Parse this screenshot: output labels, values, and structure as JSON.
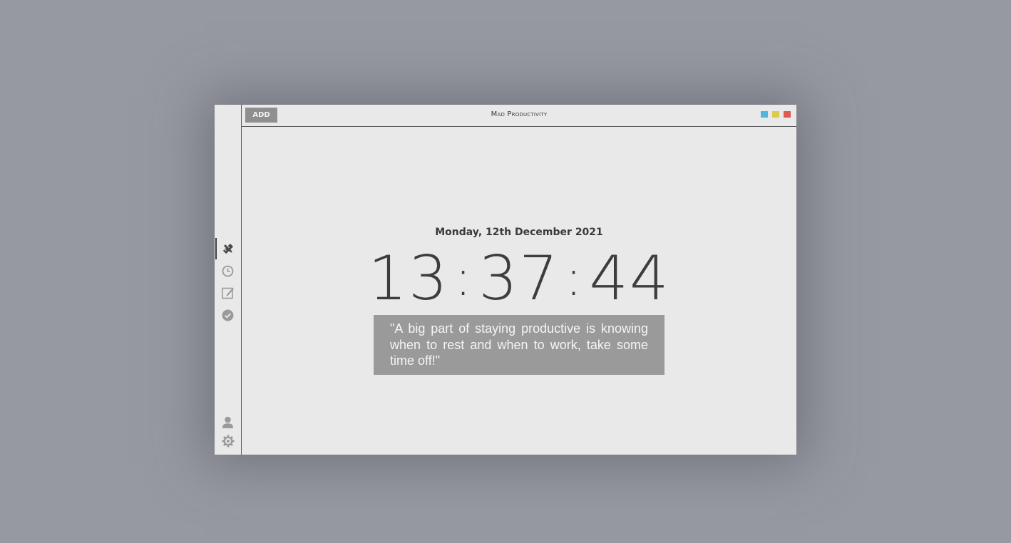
{
  "app": {
    "title": "Mad Productivity"
  },
  "toolbar": {
    "add_label": "ADD"
  },
  "window_controls": [
    {
      "name": "minimize",
      "color": "#4fb6dd"
    },
    {
      "name": "maximize",
      "color": "#dccb4c"
    },
    {
      "name": "close",
      "color": "#de5a4f"
    }
  ],
  "sidebar": {
    "items": [
      {
        "name": "dashboard",
        "icon": "pencil-ruler-icon",
        "active": true
      },
      {
        "name": "timer",
        "icon": "clock-icon",
        "active": false
      },
      {
        "name": "notes",
        "icon": "edit-icon",
        "active": false
      },
      {
        "name": "tasks",
        "icon": "check-circle-icon",
        "active": false
      }
    ],
    "bottom_items": [
      {
        "name": "profile",
        "icon": "user-icon"
      },
      {
        "name": "settings",
        "icon": "gear-icon"
      }
    ]
  },
  "main": {
    "date": "Monday, 12th December 2021",
    "clock": {
      "hours": "13",
      "minutes": "37",
      "seconds": "44",
      "separator": ":"
    },
    "quote": "\"A big part of staying productive is knowing when to rest and when to work, take some time off!\""
  },
  "colors": {
    "background": "#9699a1",
    "window": "#e9e9e9",
    "accent_gray": "#8f8f8f",
    "text_dark": "#3d3d3d"
  }
}
